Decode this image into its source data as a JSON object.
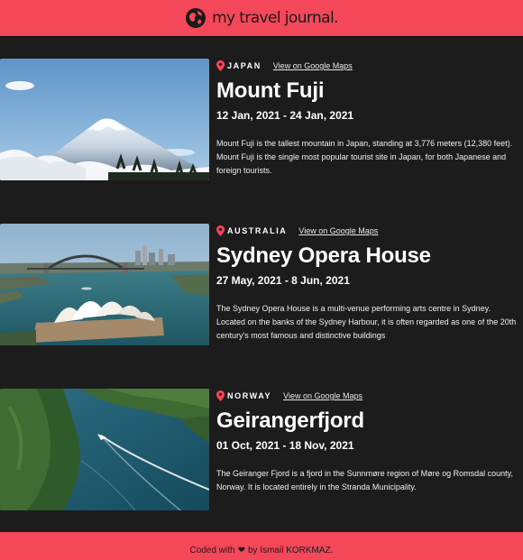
{
  "header": {
    "title": "my travel journal.",
    "logo_icon": "globe-icon"
  },
  "entries": [
    {
      "country": "JAPAN",
      "map_link": "View on Google Maps",
      "title": "Mount Fuji",
      "dates": "12 Jan, 2021 - 24 Jan, 2021",
      "description": "Mount Fuji is the tallest mountain in Japan, standing at 3,776 meters (12,380 feet). Mount Fuji is the single most popular tourist site in Japan, for both Japanese and foreign tourists.",
      "image_subject": "snow-capped mountain above clouds"
    },
    {
      "country": "AUSTRALIA",
      "map_link": "View on Google Maps",
      "title": "Sydney Opera House",
      "dates": "27 May, 2021 - 8 Jun, 2021",
      "description": "The Sydney Opera House is a multi-venue performing arts centre in Sydney. Located on the banks of the Sydney Harbour, it is often regarded as one of the 20th century's most famous and distinctive buildings",
      "image_subject": "opera house and harbour bridge"
    },
    {
      "country": "NORWAY",
      "map_link": "View on Google Maps",
      "title": "Geirangerfjord",
      "dates": "01 Oct, 2021 - 18 Nov, 2021",
      "description": "The Geiranger Fjord is a fjord in the Sunnmøre region of Møre og Romsdal county, Norway. It is located entirely in the Stranda Municipality.",
      "image_subject": "boat on a green fjord"
    }
  ],
  "footer": {
    "prefix": "Coded with",
    "heart": "❤",
    "suffix": "by Ismail KORKMAZ."
  },
  "colors": {
    "accent": "#f5475a",
    "background": "#1c1c1c",
    "text": "#ffffff"
  }
}
